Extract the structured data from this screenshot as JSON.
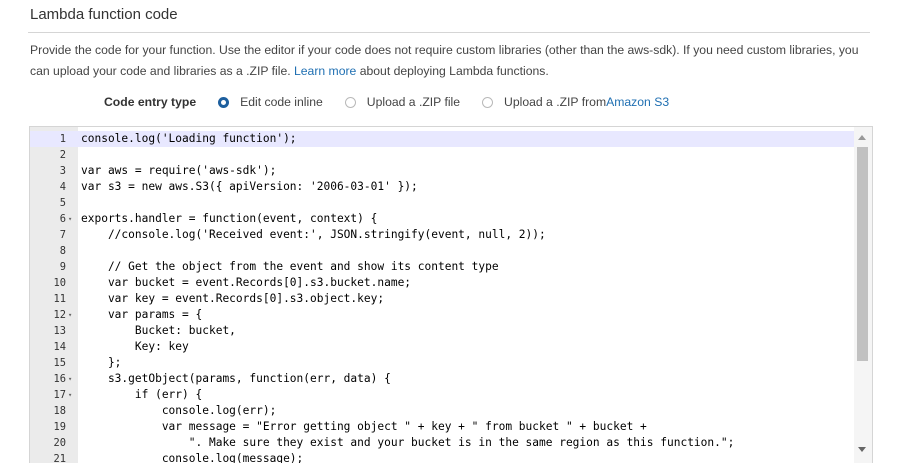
{
  "section": {
    "title": "Lambda function code",
    "description_pre": "Provide the code for your function. Use the editor if your code does not require custom libraries (other than the aws-sdk). If you need custom libraries, you can upload your code and libraries as a .ZIP file. ",
    "learn_more_link": "Learn more",
    "description_post": " about deploying Lambda functions."
  },
  "entry_type": {
    "label": "Code entry type",
    "options": [
      {
        "label": "Edit code inline",
        "selected": true
      },
      {
        "label": "Upload a .ZIP file",
        "selected": false
      },
      {
        "label_pre": "Upload a .ZIP from ",
        "label_link": "Amazon S3",
        "selected": false
      }
    ]
  },
  "editor": {
    "lines": [
      {
        "n": "1",
        "text": "console.log('Loading function');",
        "active": true,
        "fold": false
      },
      {
        "n": "2",
        "text": "",
        "fold": false
      },
      {
        "n": "3",
        "text": "var aws = require('aws-sdk');",
        "fold": false
      },
      {
        "n": "4",
        "text": "var s3 = new aws.S3({ apiVersion: '2006-03-01' });",
        "fold": false
      },
      {
        "n": "5",
        "text": "",
        "fold": false
      },
      {
        "n": "6",
        "text": "exports.handler = function(event, context) {",
        "fold": true
      },
      {
        "n": "7",
        "text": "    //console.log('Received event:', JSON.stringify(event, null, 2));",
        "fold": false
      },
      {
        "n": "8",
        "text": "",
        "fold": false
      },
      {
        "n": "9",
        "text": "    // Get the object from the event and show its content type",
        "fold": false
      },
      {
        "n": "10",
        "text": "    var bucket = event.Records[0].s3.bucket.name;",
        "fold": false
      },
      {
        "n": "11",
        "text": "    var key = event.Records[0].s3.object.key;",
        "fold": false
      },
      {
        "n": "12",
        "text": "    var params = {",
        "fold": true
      },
      {
        "n": "13",
        "text": "        Bucket: bucket,",
        "fold": false
      },
      {
        "n": "14",
        "text": "        Key: key",
        "fold": false
      },
      {
        "n": "15",
        "text": "    };",
        "fold": false
      },
      {
        "n": "16",
        "text": "    s3.getObject(params, function(err, data) {",
        "fold": true
      },
      {
        "n": "17",
        "text": "        if (err) {",
        "fold": true
      },
      {
        "n": "18",
        "text": "            console.log(err);",
        "fold": false
      },
      {
        "n": "19",
        "text": "            var message = \"Error getting object \" + key + \" from bucket \" + bucket +",
        "fold": false
      },
      {
        "n": "20",
        "text": "                \". Make sure they exist and your bucket is in the same region as this function.\";",
        "fold": false
      },
      {
        "n": "21",
        "text": "            console.log(message);",
        "fold": false
      }
    ]
  }
}
